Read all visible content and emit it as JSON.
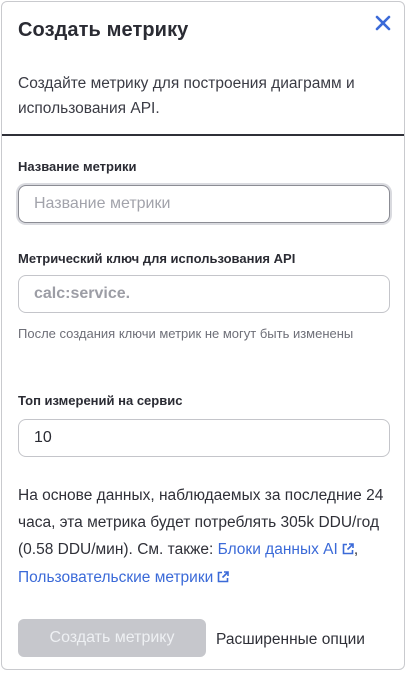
{
  "dialog": {
    "title": "Создать метрику",
    "description": "Создайте метрику для построения диаграмм и использования API.",
    "close_icon": "close-icon",
    "accent_color": "#3b6ad8"
  },
  "fields": {
    "name": {
      "label": "Название метрики",
      "value": "",
      "placeholder": "Название метрики"
    },
    "key": {
      "label": "Метрический ключ для использования API",
      "value": "",
      "placeholder": "calc:service.",
      "hint": "После создания ключи метрик не могут быть изменены"
    },
    "top": {
      "label": "Топ измерений на сервис",
      "value": "10"
    }
  },
  "info": {
    "text": "На основе данных, наблюдаемых за последние 24 часа, эта метрика будет потреблять 305k DDU/год (0.58 DDU/мин).",
    "see_also": "См. также:",
    "link1": "Блоки данных AI",
    "separator": ",",
    "link2": "Пользовательские метрики"
  },
  "actions": {
    "create_label": "Создать метрику",
    "advanced_label": "Расширенные опции"
  }
}
